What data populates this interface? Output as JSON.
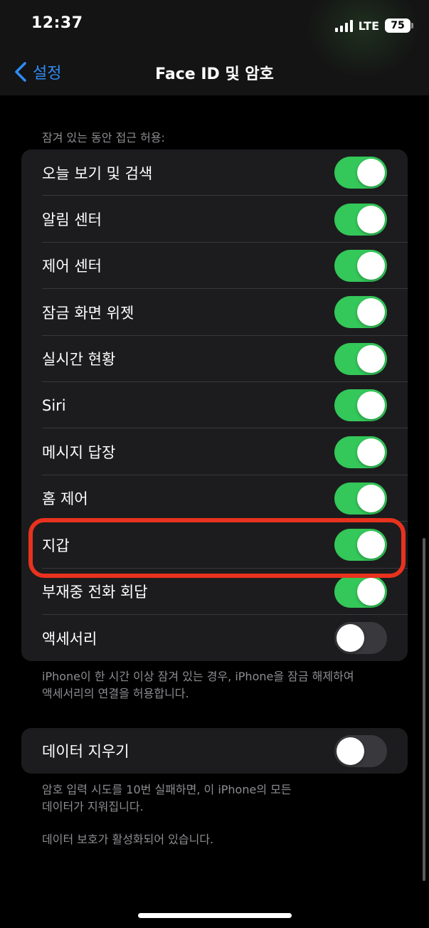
{
  "status_bar": {
    "time": "12:37",
    "network": "LTE",
    "battery": "75"
  },
  "nav": {
    "back_label": "설정",
    "title": "Face ID 및 암호"
  },
  "lock_access": {
    "header": "잠겨 있는 동안 접근 허용:",
    "items": [
      {
        "label": "오늘 보기 및 검색",
        "on": true
      },
      {
        "label": "알림 센터",
        "on": true
      },
      {
        "label": "제어 센터",
        "on": true
      },
      {
        "label": "잠금 화면 위젯",
        "on": true
      },
      {
        "label": "실시간 현황",
        "on": true
      },
      {
        "label": "Siri",
        "on": true
      },
      {
        "label": "메시지 답장",
        "on": true
      },
      {
        "label": "홈 제어",
        "on": true
      },
      {
        "label": "지갑",
        "on": true
      },
      {
        "label": "부재중 전화 회답",
        "on": true
      },
      {
        "label": "액세서리",
        "on": false
      }
    ],
    "footer": "iPhone이 한 시간 이상 잠겨 있는 경우, iPhone을 잠금 해제하여\n액세서리의 연결을 허용합니다."
  },
  "erase_data": {
    "label": "데이터 지우기",
    "on": false,
    "footer": "암호 입력 시도를 10번 실패하면, 이 iPhone의 모든\n데이터가 지워집니다.",
    "protection_note": "데이터 보호가 활성화되어 있습니다."
  },
  "colors": {
    "accent": "#2f8bf5",
    "toggle_on": "#34c759",
    "toggle_off": "#39393d",
    "highlight": "#e8321e",
    "cell_bg": "#1c1c1e"
  }
}
